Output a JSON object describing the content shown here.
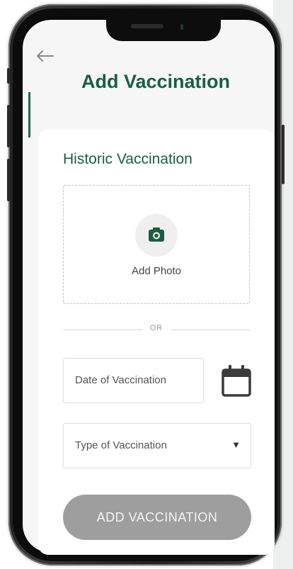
{
  "header": {
    "back_icon": "arrow-left-icon",
    "title": "Add Vaccination"
  },
  "form": {
    "section_title": "Historic Vaccination",
    "photo": {
      "icon": "camera-icon",
      "label": "Add Photo"
    },
    "divider_text": "OR",
    "date_field": {
      "label": "Date of Vaccination",
      "icon": "calendar-icon"
    },
    "type_field": {
      "label": "Type of Vaccination",
      "icon": "caret-down-icon",
      "caret": "▼"
    },
    "submit_label": "ADD VACCINATION"
  },
  "colors": {
    "brand_green": "#1b5e41",
    "button_disabled": "#9e9e9e",
    "screen_background": "#f6f6f6"
  }
}
